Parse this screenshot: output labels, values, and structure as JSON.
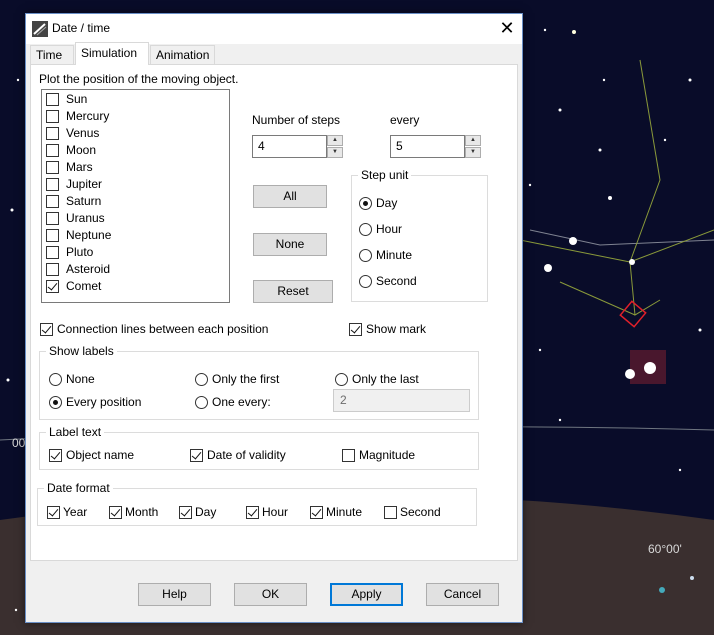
{
  "sky": {
    "labels": [
      "00",
      "60°00'"
    ]
  },
  "dialog": {
    "title": "Date / time",
    "close_glyph": "✕",
    "tabs": [
      "Time",
      "Simulation",
      "Animation"
    ],
    "active_tab": "Simulation",
    "plot_heading": "Plot the position of the moving object.",
    "objects": [
      {
        "label": "Sun",
        "checked": false
      },
      {
        "label": "Mercury",
        "checked": false
      },
      {
        "label": "Venus",
        "checked": false
      },
      {
        "label": "Moon",
        "checked": false
      },
      {
        "label": "Mars",
        "checked": false
      },
      {
        "label": "Jupiter",
        "checked": false
      },
      {
        "label": "Saturn",
        "checked": false
      },
      {
        "label": "Uranus",
        "checked": false
      },
      {
        "label": "Neptune",
        "checked": false
      },
      {
        "label": "Pluto",
        "checked": false
      },
      {
        "label": "Asteroid",
        "checked": false
      },
      {
        "label": "Comet",
        "checked": true
      }
    ],
    "steps": {
      "label": "Number of steps",
      "value": "4"
    },
    "every": {
      "label": "every",
      "value": "5"
    },
    "buttons": {
      "all": "All",
      "none": "None",
      "reset": "Reset"
    },
    "step_unit": {
      "title": "Step unit",
      "options": [
        "Day",
        "Hour",
        "Minute",
        "Second"
      ],
      "selected": "Day"
    },
    "connection_lines": {
      "label": "Connection lines between each position",
      "checked": true
    },
    "show_mark": {
      "label": "Show mark",
      "checked": true
    },
    "show_labels": {
      "title": "Show labels",
      "options": [
        "None",
        "Only the first",
        "Only the last",
        "Every position",
        "One every:"
      ],
      "selected": "Every position",
      "one_every_value": "2"
    },
    "label_text": {
      "title": "Label text",
      "items": [
        {
          "label": "Object name",
          "checked": true
        },
        {
          "label": "Date of validity",
          "checked": true
        },
        {
          "label": "Magnitude",
          "checked": false
        }
      ]
    },
    "date_format": {
      "title": "Date format",
      "items": [
        {
          "label": "Year",
          "checked": true
        },
        {
          "label": "Month",
          "checked": true
        },
        {
          "label": "Day",
          "checked": true
        },
        {
          "label": "Hour",
          "checked": true
        },
        {
          "label": "Minute",
          "checked": true
        },
        {
          "label": "Second",
          "checked": false
        }
      ]
    },
    "footer": {
      "help": "Help",
      "ok": "OK",
      "apply": "Apply",
      "cancel": "Cancel"
    }
  }
}
